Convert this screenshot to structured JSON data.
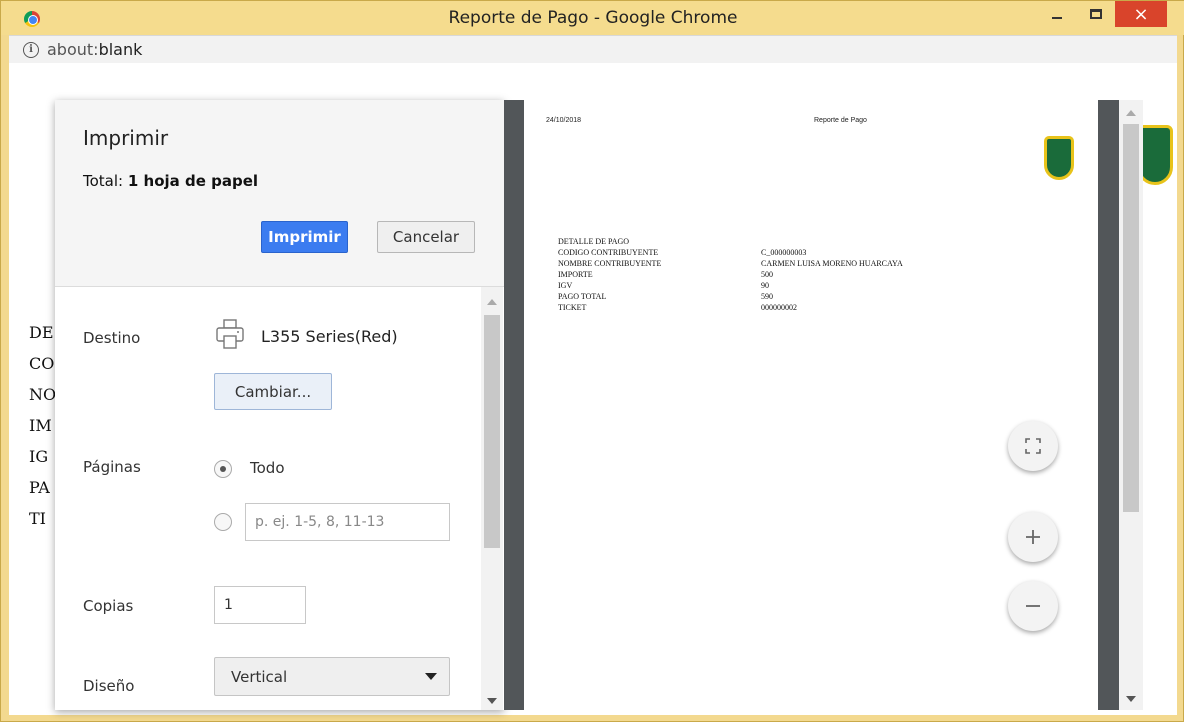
{
  "window": {
    "title": "Reporte de Pago - Google Chrome",
    "close_label": "×"
  },
  "address": {
    "scheme": "about:",
    "path": "blank"
  },
  "background_page": {
    "lines": [
      "DE",
      "CO",
      "NO",
      "IM",
      "IG",
      "PA",
      "TI"
    ]
  },
  "print_dialog": {
    "title": "Imprimir",
    "total_prefix": "Total:",
    "total_value": "1 hoja de papel",
    "print_button": "Imprimir",
    "cancel_button": "Cancelar",
    "destination_label": "Destino",
    "printer_name": "L355 Series(Red)",
    "change_button": "Cambiar...",
    "pages_label": "Páginas",
    "pages_all": "Todo",
    "pages_range_placeholder": "p. ej. 1-5, 8, 11-13",
    "copies_label": "Copias",
    "copies_value": "1",
    "layout_label": "Diseño",
    "layout_value": "Vertical"
  },
  "preview": {
    "date": "24/10/2018",
    "title": "Reporte de Pago",
    "heading": "DETALLE DE PAGO",
    "rows": [
      {
        "key": "CODIGO CONTRIBUYENTE",
        "value": "C_000000003"
      },
      {
        "key": "NOMBRE CONTRIBUYENTE",
        "value": "CARMEN LUISA MORENO HUARCAYA"
      },
      {
        "key": "IMPORTE",
        "value": "500"
      },
      {
        "key": "IGV",
        "value": "90"
      },
      {
        "key": "PAGO TOTAL",
        "value": "590"
      },
      {
        "key": "TICKET",
        "value": "000000002"
      }
    ]
  },
  "colors": {
    "title_bar": "#f5dc8e",
    "close_button": "#d9442b",
    "print_button": "#3b7cf0",
    "preview_background": "#525659"
  }
}
